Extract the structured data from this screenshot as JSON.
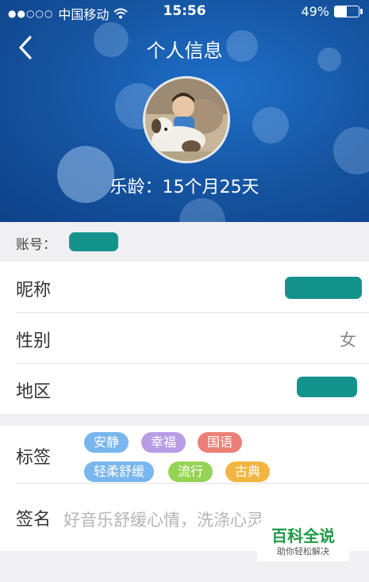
{
  "status_bar": {
    "carrier": "中国移动",
    "time": "15:56",
    "battery": "49%",
    "battery_level": 0.49
  },
  "nav": {
    "title": "个人信息"
  },
  "profile": {
    "age_text": "乐龄：15个月25天"
  },
  "account": {
    "label": "账号："
  },
  "rows": {
    "nickname": {
      "label": "昵称"
    },
    "gender": {
      "label": "性别",
      "value": "女"
    },
    "region": {
      "label": "地区"
    }
  },
  "tags_section": {
    "label": "标签",
    "tags": [
      {
        "text": "安静",
        "color": "#7ab6ee"
      },
      {
        "text": "幸福",
        "color": "#b89ce6"
      },
      {
        "text": "国语",
        "color": "#ec7f76"
      },
      {
        "text": "轻柔舒缓",
        "color": "#7ab6ee"
      },
      {
        "text": "流行",
        "color": "#97d355"
      },
      {
        "text": "古典",
        "color": "#f2b640"
      }
    ]
  },
  "signature": {
    "label": "签名",
    "value": "好音乐舒缓心情，洗涤心灵"
  },
  "watermark": {
    "main": "百科全说",
    "sub": "助你轻松解决"
  },
  "colors": {
    "header_bg": "#15539f",
    "mask": "#14938c",
    "watermark_green": "#1c9c47"
  }
}
